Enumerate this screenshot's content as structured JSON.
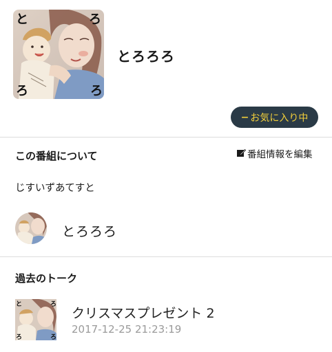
{
  "program": {
    "title": "とろろろ",
    "cover_icon": "mother-and-baby-drawing",
    "cover_letters": [
      "と",
      "ろ",
      "ろ",
      "ろ"
    ],
    "favorite_button": {
      "icon": "minus-icon",
      "label": "お気に入り中"
    }
  },
  "about": {
    "heading": "この番組について",
    "edit_icon": "edit-icon",
    "edit_label": "番組情報を編集",
    "description": "じすいずあてすと",
    "host_name": "とろろろ"
  },
  "past_talks": {
    "heading": "過去のトーク",
    "items": [
      {
        "title": "クリスマスプレゼント 2",
        "date": "2017-12-25 21:23:19"
      }
    ]
  },
  "colors": {
    "button_bg": "#2a3a46",
    "button_text": "#f3cf3a",
    "divider": "#dcdcdc",
    "muted_text": "#9a9a9a"
  }
}
